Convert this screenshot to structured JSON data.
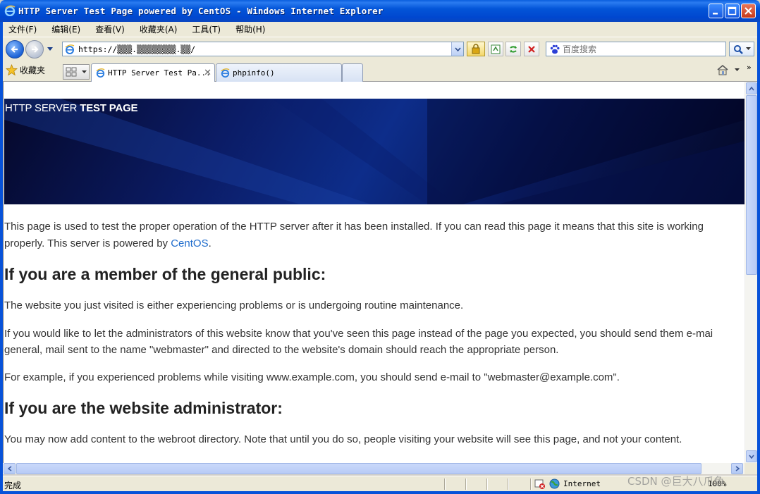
{
  "window": {
    "title": "HTTP Server Test Page powered by CentOS - Windows Internet Explorer"
  },
  "menu": [
    "文件(F)",
    "编辑(E)",
    "查看(V)",
    "收藏夹(A)",
    "工具(T)",
    "帮助(H)"
  ],
  "address": {
    "value": "https://▒▒▒.▒▒▒▒▒▒▒▒.▒▒/"
  },
  "search": {
    "placeholder": "百度搜索"
  },
  "favorites": {
    "label": "收藏夹"
  },
  "tabs": [
    {
      "label": "HTTP Server Test Pa...",
      "active": true
    },
    {
      "label": "phpinfo()",
      "active": false
    }
  ],
  "page": {
    "banner_title_normal": "HTTP SERVER ",
    "banner_title_bold": "TEST PAGE",
    "intro_before": "This page is used to test the proper operation of the HTTP server after it has been installed. If you can read this page it means that this site is working properly. This server is powered by ",
    "intro_link": "CentOS",
    "intro_after": ".",
    "h_public": "If you are a member of the general public:",
    "p_public_1": "The website you just visited is either experiencing problems or is undergoing routine maintenance.",
    "p_public_2a": "If you would like to let the administrators of this website know that you've seen this page instead of the page you expected, you should send them e-mai",
    "p_public_2b": "general, mail sent to the name \"webmaster\" and directed to the website's domain should reach the appropriate person.",
    "p_public_3": "For example, if you experienced problems while visiting www.example.com, you should send e-mail to \"webmaster@example.com\".",
    "h_admin": "If you are the website administrator:",
    "p_admin_1": "You may now add content to the webroot directory. Note that until you do so, people visiting your website will see this page, and not your content."
  },
  "status": {
    "text": "完成",
    "zone": "Internet",
    "zoom": "100%"
  },
  "watermark": "CSDN @巨大八爪鱼",
  "colors": {
    "titlebar": "#0355d8",
    "link": "#1f6ccc",
    "banner": "#0b1c66"
  }
}
